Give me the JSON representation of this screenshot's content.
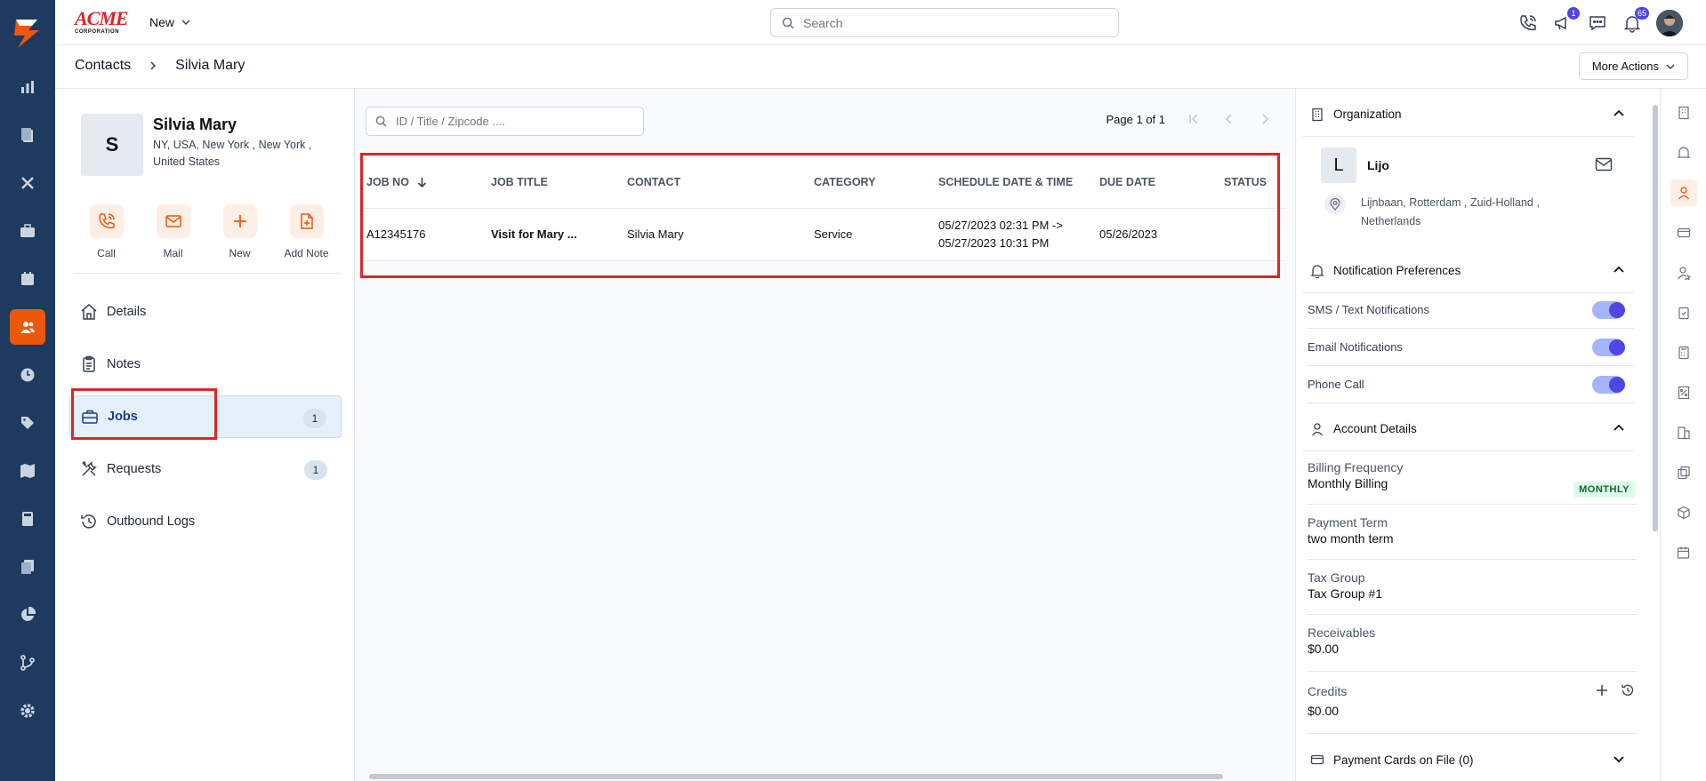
{
  "topbar": {
    "brand_line1": "ACME",
    "brand_line2": "CORPORATION",
    "new_label": "New",
    "search_placeholder": "Search",
    "announcements_badge": "1",
    "notifications_badge": "65"
  },
  "breadcrumb": {
    "root": "Contacts",
    "current": "Silvia Mary"
  },
  "more_actions_label": "More Actions",
  "contact": {
    "initial": "S",
    "name": "Silvia Mary",
    "address": "NY, USA, New York , New York , United States",
    "actions": [
      {
        "label": "Call",
        "icon": "phone-icon"
      },
      {
        "label": "Mail",
        "icon": "mail-icon"
      },
      {
        "label": "New",
        "icon": "plus-icon"
      },
      {
        "label": "Add Note",
        "icon": "add-note-icon"
      }
    ],
    "nav": [
      {
        "label": "Details",
        "icon": "home-icon"
      },
      {
        "label": "Notes",
        "icon": "clipboard-icon"
      },
      {
        "label": "Jobs",
        "icon": "briefcase-icon",
        "count": "1",
        "active": true
      },
      {
        "label": "Requests",
        "icon": "tools-icon",
        "count": "1"
      },
      {
        "label": "Outbound Logs",
        "icon": "history-icon"
      }
    ]
  },
  "jobs": {
    "filter_placeholder": "ID / Title / Zipcode ....",
    "page_label": "Page 1 of 1",
    "columns": [
      "JOB NO",
      "JOB TITLE",
      "CONTACT",
      "CATEGORY",
      "SCHEDULE DATE & TIME",
      "DUE DATE",
      "STATUS"
    ],
    "rows": [
      {
        "job_no": "A12345176",
        "title": "Visit for Mary ...",
        "contact": "Silvia Mary",
        "category": "Service",
        "schedule_start": "05/27/2023 02:31 PM ->",
        "schedule_end": "05/27/2023 10:31 PM",
        "due": "05/26/2023",
        "status": ""
      }
    ]
  },
  "right": {
    "organization": {
      "title": "Organization",
      "initial": "L",
      "name": "Lijo",
      "address": "Lijnbaan, Rotterdam , Zuid-Holland , Netherlands"
    },
    "notifications": {
      "title": "Notification Preferences",
      "items": [
        {
          "label": "SMS / Text Notifications",
          "on": true
        },
        {
          "label": "Email Notifications",
          "on": true
        },
        {
          "label": "Phone Call",
          "on": true
        }
      ]
    },
    "account": {
      "title": "Account Details",
      "billing_label": "Billing Frequency",
      "billing_value": "Monthly Billing",
      "billing_badge": "MONTHLY",
      "payment_label": "Payment Term",
      "payment_value": "two month term",
      "tax_label": "Tax Group",
      "tax_value": "Tax Group #1",
      "receivables_label": "Receivables",
      "receivables_value": "$0.00",
      "credits_label": "Credits",
      "credits_value": "$0.00"
    },
    "payment_cards_title": "Payment Cards on File (0)"
  },
  "colors": {
    "rail": "#1e3a5f",
    "accent": "#ea580c",
    "toggle": "#4f46e5",
    "highlight": "#dc2626"
  }
}
